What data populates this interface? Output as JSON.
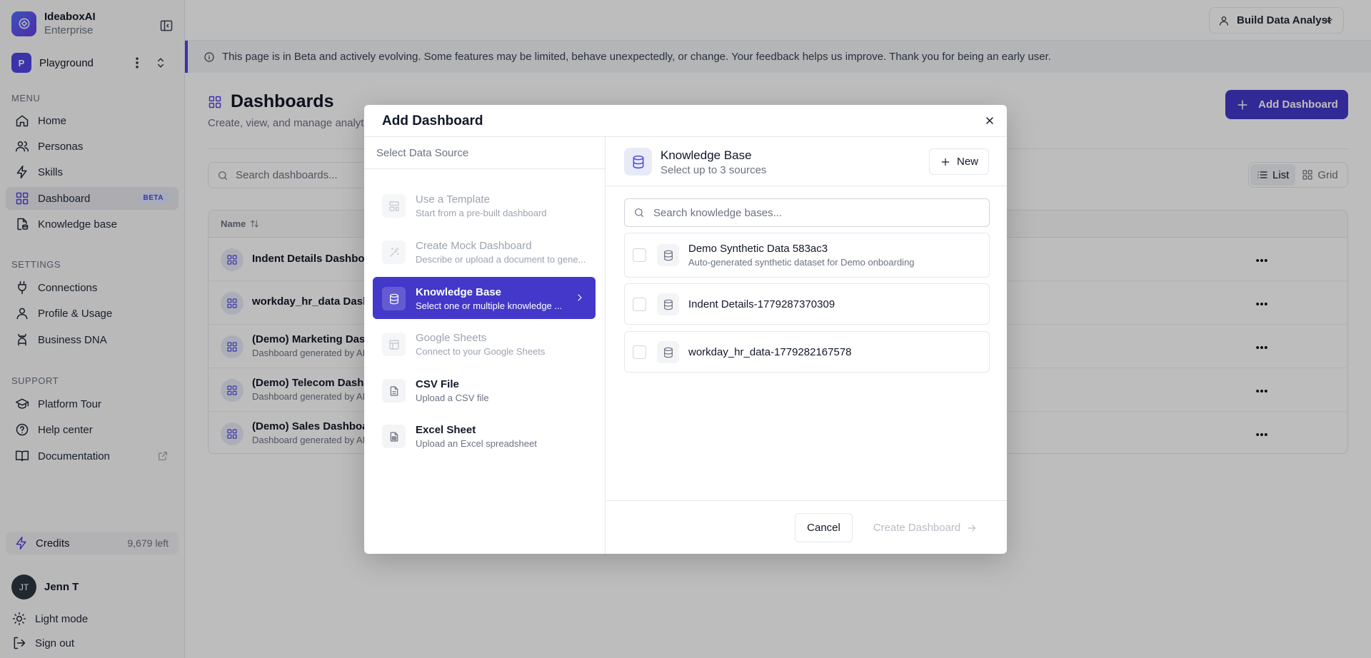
{
  "brand": {
    "name": "IdeaboxAI",
    "plan": "Enterprise"
  },
  "workspace": {
    "initial": "P",
    "name": "Playground"
  },
  "menu": {
    "section": "MENU",
    "items": [
      {
        "label": "Home"
      },
      {
        "label": "Personas"
      },
      {
        "label": "Skills"
      },
      {
        "label": "Dashboard",
        "badge": "BETA"
      },
      {
        "label": "Knowledge base"
      }
    ]
  },
  "settings": {
    "section": "SETTINGS",
    "items": [
      {
        "label": "Connections"
      },
      {
        "label": "Profile & Usage"
      },
      {
        "label": "Business DNA"
      }
    ]
  },
  "support": {
    "section": "SUPPORT",
    "items": [
      {
        "label": "Platform Tour"
      },
      {
        "label": "Help center"
      },
      {
        "label": "Documentation"
      }
    ]
  },
  "credits": {
    "label": "Credits",
    "value": "9,679 left"
  },
  "user": {
    "initials": "JT",
    "name": "Jenn T"
  },
  "bottom": {
    "light_mode": "Light mode",
    "sign_out": "Sign out"
  },
  "header": {
    "role": "Build Data Analyst"
  },
  "banner": {
    "text": "This page is in Beta and actively evolving. Some features may be limited, behave unexpectedly, or change. Your feedback helps us improve. Thank you for being an early user."
  },
  "page": {
    "title": "Dashboards",
    "subtitle": "Create, view, and manage analyt",
    "add_button": "Add Dashboard",
    "search_placeholder": "Search dashboards...",
    "view_list": "List",
    "view_grid": "Grid",
    "column_name": "Name"
  },
  "rows": [
    {
      "name": "Indent Details Dashboa",
      "desc": ""
    },
    {
      "name": "workday_hr_data Dashb",
      "desc": ""
    },
    {
      "name": "(Demo) Marketing Dash",
      "desc": "Dashboard generated by AI"
    },
    {
      "name": "(Demo) Telecom Dashb",
      "desc": "Dashboard generated by AI"
    },
    {
      "name": "(Demo) Sales Dashboar",
      "desc": "Dashboard generated by AI"
    }
  ],
  "modal": {
    "title": "Add Dashboard",
    "left_header": "Select Data Source",
    "sources": [
      {
        "title": "Use a Template",
        "desc": "Start from a pre-built dashboard"
      },
      {
        "title": "Create Mock Dashboard",
        "desc": "Describe or upload a document to gene..."
      },
      {
        "title": "Knowledge Base",
        "desc": "Select one or multiple knowledge ..."
      },
      {
        "title": "Google Sheets",
        "desc": "Connect to your Google Sheets"
      },
      {
        "title": "CSV File",
        "desc": "Upload a CSV file"
      },
      {
        "title": "Excel Sheet",
        "desc": "Upload an Excel spreadsheet"
      }
    ],
    "kb_title": "Knowledge Base",
    "kb_sub": "Select up to 3 sources",
    "new_button": "New",
    "kb_search_placeholder": "Search knowledge bases...",
    "kb_items": [
      {
        "name": "Demo Synthetic Data 583ac3",
        "desc": "Auto-generated synthetic dataset for Demo onboarding"
      },
      {
        "name": "Indent Details-1779287370309",
        "desc": ""
      },
      {
        "name": "workday_hr_data-1779282167578",
        "desc": ""
      }
    ],
    "cancel": "Cancel",
    "create": "Create Dashboard"
  }
}
